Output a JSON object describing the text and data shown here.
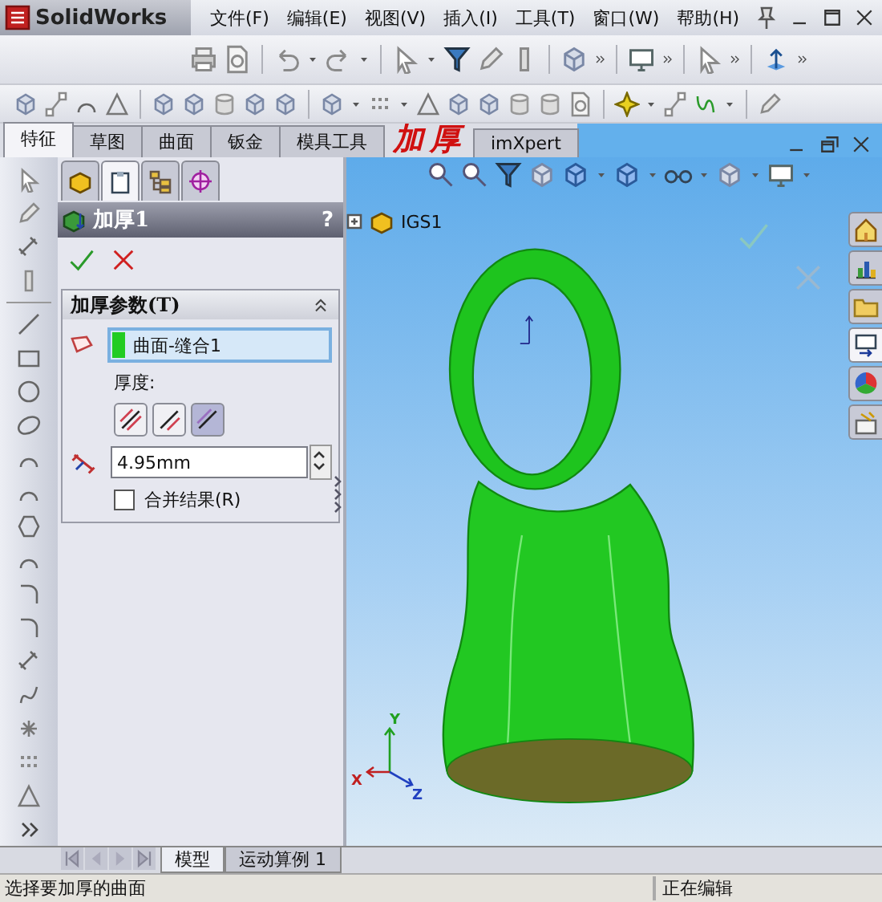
{
  "title_bar": {
    "app_name": "SolidWorks"
  },
  "menu": [
    {
      "label": "文件(F)"
    },
    {
      "label": "编辑(E)"
    },
    {
      "label": "视图(V)"
    },
    {
      "label": "插入(I)"
    },
    {
      "label": "工具(T)"
    },
    {
      "label": "窗口(W)"
    },
    {
      "label": "帮助(H)"
    }
  ],
  "command_tabs": [
    {
      "label": "特征",
      "selected": true
    },
    {
      "label": "草图",
      "selected": false
    },
    {
      "label": "曲面",
      "selected": false
    },
    {
      "label": "钣金",
      "selected": false
    },
    {
      "label": "模具工具",
      "selected": false
    },
    {
      "label": "imXpert",
      "selected": false
    }
  ],
  "annotation": "加厚",
  "panel_tabs": [
    {
      "selected": false
    },
    {
      "selected": true
    },
    {
      "selected": false
    },
    {
      "selected": false
    }
  ],
  "property_manager": {
    "title": "加厚1",
    "help": "?",
    "group": {
      "title": "加厚参数(T)",
      "selection": "曲面-缝合1",
      "thickness_label": "厚度:",
      "sides": [
        {
          "selected": false
        },
        {
          "selected": false
        },
        {
          "selected": true
        }
      ],
      "thickness_value": "4.95mm",
      "merge": {
        "label": "合并结果(R)",
        "checked": false
      }
    }
  },
  "tree": {
    "label": "IGS1"
  },
  "triad": [
    "X",
    "Y",
    "Z"
  ],
  "task_pane": [
    {
      "selected": false
    },
    {
      "selected": false
    },
    {
      "selected": false
    },
    {
      "selected": true
    },
    {
      "selected": false
    },
    {
      "selected": false
    }
  ],
  "bottom_tabs": [
    {
      "label": "模型",
      "selected": true
    },
    {
      "label": "运动算例 1",
      "selected": false
    }
  ],
  "status_bar": {
    "message": "选择要加厚的曲面",
    "mode": "正在编辑"
  }
}
